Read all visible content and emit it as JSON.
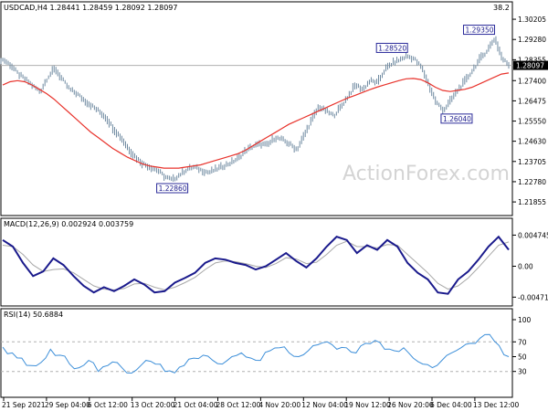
{
  "chart_data": [
    {
      "type": "candlestick",
      "title": "USDCAD,H4  1.28441 1.28459 1.28092 1.28097",
      "corner_label": "38.2",
      "watermark": "ActionForex.com",
      "y_ticks": [
        "1.30205",
        "1.29280",
        "1.28355",
        "1.27400",
        "1.26475",
        "1.25550",
        "1.24630",
        "1.23705",
        "1.22780",
        "1.21855"
      ],
      "ylim": [
        1.214,
        1.305
      ],
      "current_price": "1.28097",
      "current_price_value": 1.28097,
      "annotations": [
        {
          "text": "1.22860",
          "value": 1.2286,
          "x_index": 0.335
        },
        {
          "text": "1.28520",
          "value": 1.2852,
          "x_index": 0.8
        },
        {
          "text": "1.26040",
          "value": 1.2604,
          "x_index": 0.897
        },
        {
          "text": "1.29350",
          "value": 1.2935,
          "x_index": 0.972
        }
      ],
      "price_series": [
        1.2835,
        1.281,
        1.277,
        1.2745,
        1.2715,
        1.269,
        1.2755,
        1.2795,
        1.2745,
        1.27,
        1.268,
        1.265,
        1.2625,
        1.26,
        1.257,
        1.252,
        1.248,
        1.243,
        1.239,
        1.236,
        1.2345,
        1.233,
        1.23,
        1.2286,
        1.231,
        1.2335,
        1.2345,
        1.233,
        1.232,
        1.2335,
        1.235,
        1.2365,
        1.2385,
        1.242,
        1.244,
        1.245,
        1.2445,
        1.248,
        1.247,
        1.245,
        1.2425,
        1.249,
        1.256,
        1.262,
        1.26,
        1.258,
        1.262,
        1.267,
        1.272,
        1.27,
        1.274,
        1.273,
        1.279,
        1.282,
        1.2835,
        1.2852,
        1.284,
        1.28,
        1.272,
        1.264,
        1.2604,
        1.265,
        1.27,
        1.274,
        1.279,
        1.284,
        1.288,
        1.2935,
        1.284,
        1.28097
      ],
      "ma_series": [
        1.272,
        1.2735,
        1.274,
        1.2735,
        1.272,
        1.27,
        1.268,
        1.2655,
        1.2625,
        1.2595,
        1.2565,
        1.2535,
        1.2505,
        1.248,
        1.2455,
        1.243,
        1.241,
        1.239,
        1.2375,
        1.236,
        1.235,
        1.2345,
        1.234,
        1.234,
        1.234,
        1.2345,
        1.235,
        1.2355,
        1.2365,
        1.2375,
        1.2385,
        1.2395,
        1.2405,
        1.242,
        1.244,
        1.246,
        1.248,
        1.25,
        1.252,
        1.254,
        1.2555,
        1.257,
        1.2585,
        1.26,
        1.2615,
        1.263,
        1.2645,
        1.266,
        1.2672,
        1.2685,
        1.2698,
        1.271,
        1.272,
        1.273,
        1.274,
        1.2748,
        1.275,
        1.2745,
        1.273,
        1.271,
        1.2695,
        1.269,
        1.2695,
        1.27,
        1.271,
        1.2725,
        1.274,
        1.2755,
        1.277,
        1.2775
      ],
      "colors": {
        "price": "#6f8aa1",
        "ma": "#e8332c",
        "grid": "#c0c0c0",
        "current_price_line": "#b0b0b0"
      }
    },
    {
      "type": "line",
      "title": "MACD(12,26,9) 0.002924 0.003759",
      "y_ticks": [
        "0.004745",
        "0.00",
        "-0.004712"
      ],
      "ylim": [
        -0.0055,
        0.0055
      ],
      "macd_series": [
        0.004,
        0.003,
        0.0005,
        -0.0015,
        -0.0008,
        0.0012,
        0.0002,
        -0.0015,
        -0.003,
        -0.004,
        -0.0032,
        -0.0038,
        -0.003,
        -0.002,
        -0.0028,
        -0.004,
        -0.0038,
        -0.0025,
        -0.0018,
        -0.001,
        0.0005,
        0.0012,
        0.001,
        0.0005,
        0.0002,
        -0.0005,
        0.0,
        0.001,
        0.002,
        0.0008,
        -0.0002,
        0.0012,
        0.003,
        0.0045,
        0.004,
        0.002,
        0.0032,
        0.0025,
        0.004,
        0.003,
        0.0005,
        -0.001,
        -0.002,
        -0.004,
        -0.0042,
        -0.002,
        -0.0008,
        0.001,
        0.003,
        0.0045,
        0.0025
      ],
      "signal_series": [
        0.0032,
        0.003,
        0.0018,
        0.0002,
        -0.0008,
        -0.0005,
        -0.0004,
        -0.001,
        -0.002,
        -0.003,
        -0.0035,
        -0.0036,
        -0.0034,
        -0.0027,
        -0.0026,
        -0.0032,
        -0.0036,
        -0.0032,
        -0.0025,
        -0.0017,
        -0.0005,
        0.0005,
        0.0008,
        0.0007,
        0.0004,
        0.0,
        -0.0002,
        0.0004,
        0.0013,
        0.0011,
        0.0004,
        0.0006,
        0.0018,
        0.0032,
        0.0038,
        0.003,
        0.003,
        0.0028,
        0.0033,
        0.0032,
        0.0018,
        0.0004,
        -0.001,
        -0.0026,
        -0.0035,
        -0.003,
        -0.0018,
        -0.0002,
        0.0015,
        0.0032,
        0.0037
      ],
      "colors": {
        "macd": "#1a1a8c",
        "signal": "#a8a8a8"
      }
    },
    {
      "type": "line",
      "title": "RSI(14) 50.6884",
      "y_ticks": [
        "100",
        "70",
        "50",
        "30"
      ],
      "ylim": [
        0,
        100
      ],
      "levels": [
        70,
        30
      ],
      "rsi_series": [
        63,
        55,
        48,
        38,
        42,
        60,
        52,
        40,
        35,
        45,
        30,
        38,
        42,
        28,
        32,
        45,
        40,
        30,
        28,
        38,
        48,
        52,
        45,
        40,
        50,
        55,
        48,
        45,
        58,
        62,
        55,
        50,
        58,
        66,
        70,
        60,
        62,
        55,
        68,
        72,
        60,
        58,
        62,
        48,
        40,
        35,
        45,
        55,
        62,
        68,
        75,
        80,
        65,
        50
      ],
      "color": "#3d8fd9"
    }
  ],
  "x_axis": {
    "labels": [
      "21 Sep 2021",
      "29 Sep 04:00",
      "6 Oct 12:00",
      "13 Oct 20:00",
      "21 Oct 04:00",
      "28 Oct 12:00",
      "4 Nov 20:00",
      "12 Nov 04:00",
      "19 Nov 12:00",
      "26 Nov 20:00",
      "6 Dec 04:00",
      "13 Dec 12:00"
    ]
  }
}
